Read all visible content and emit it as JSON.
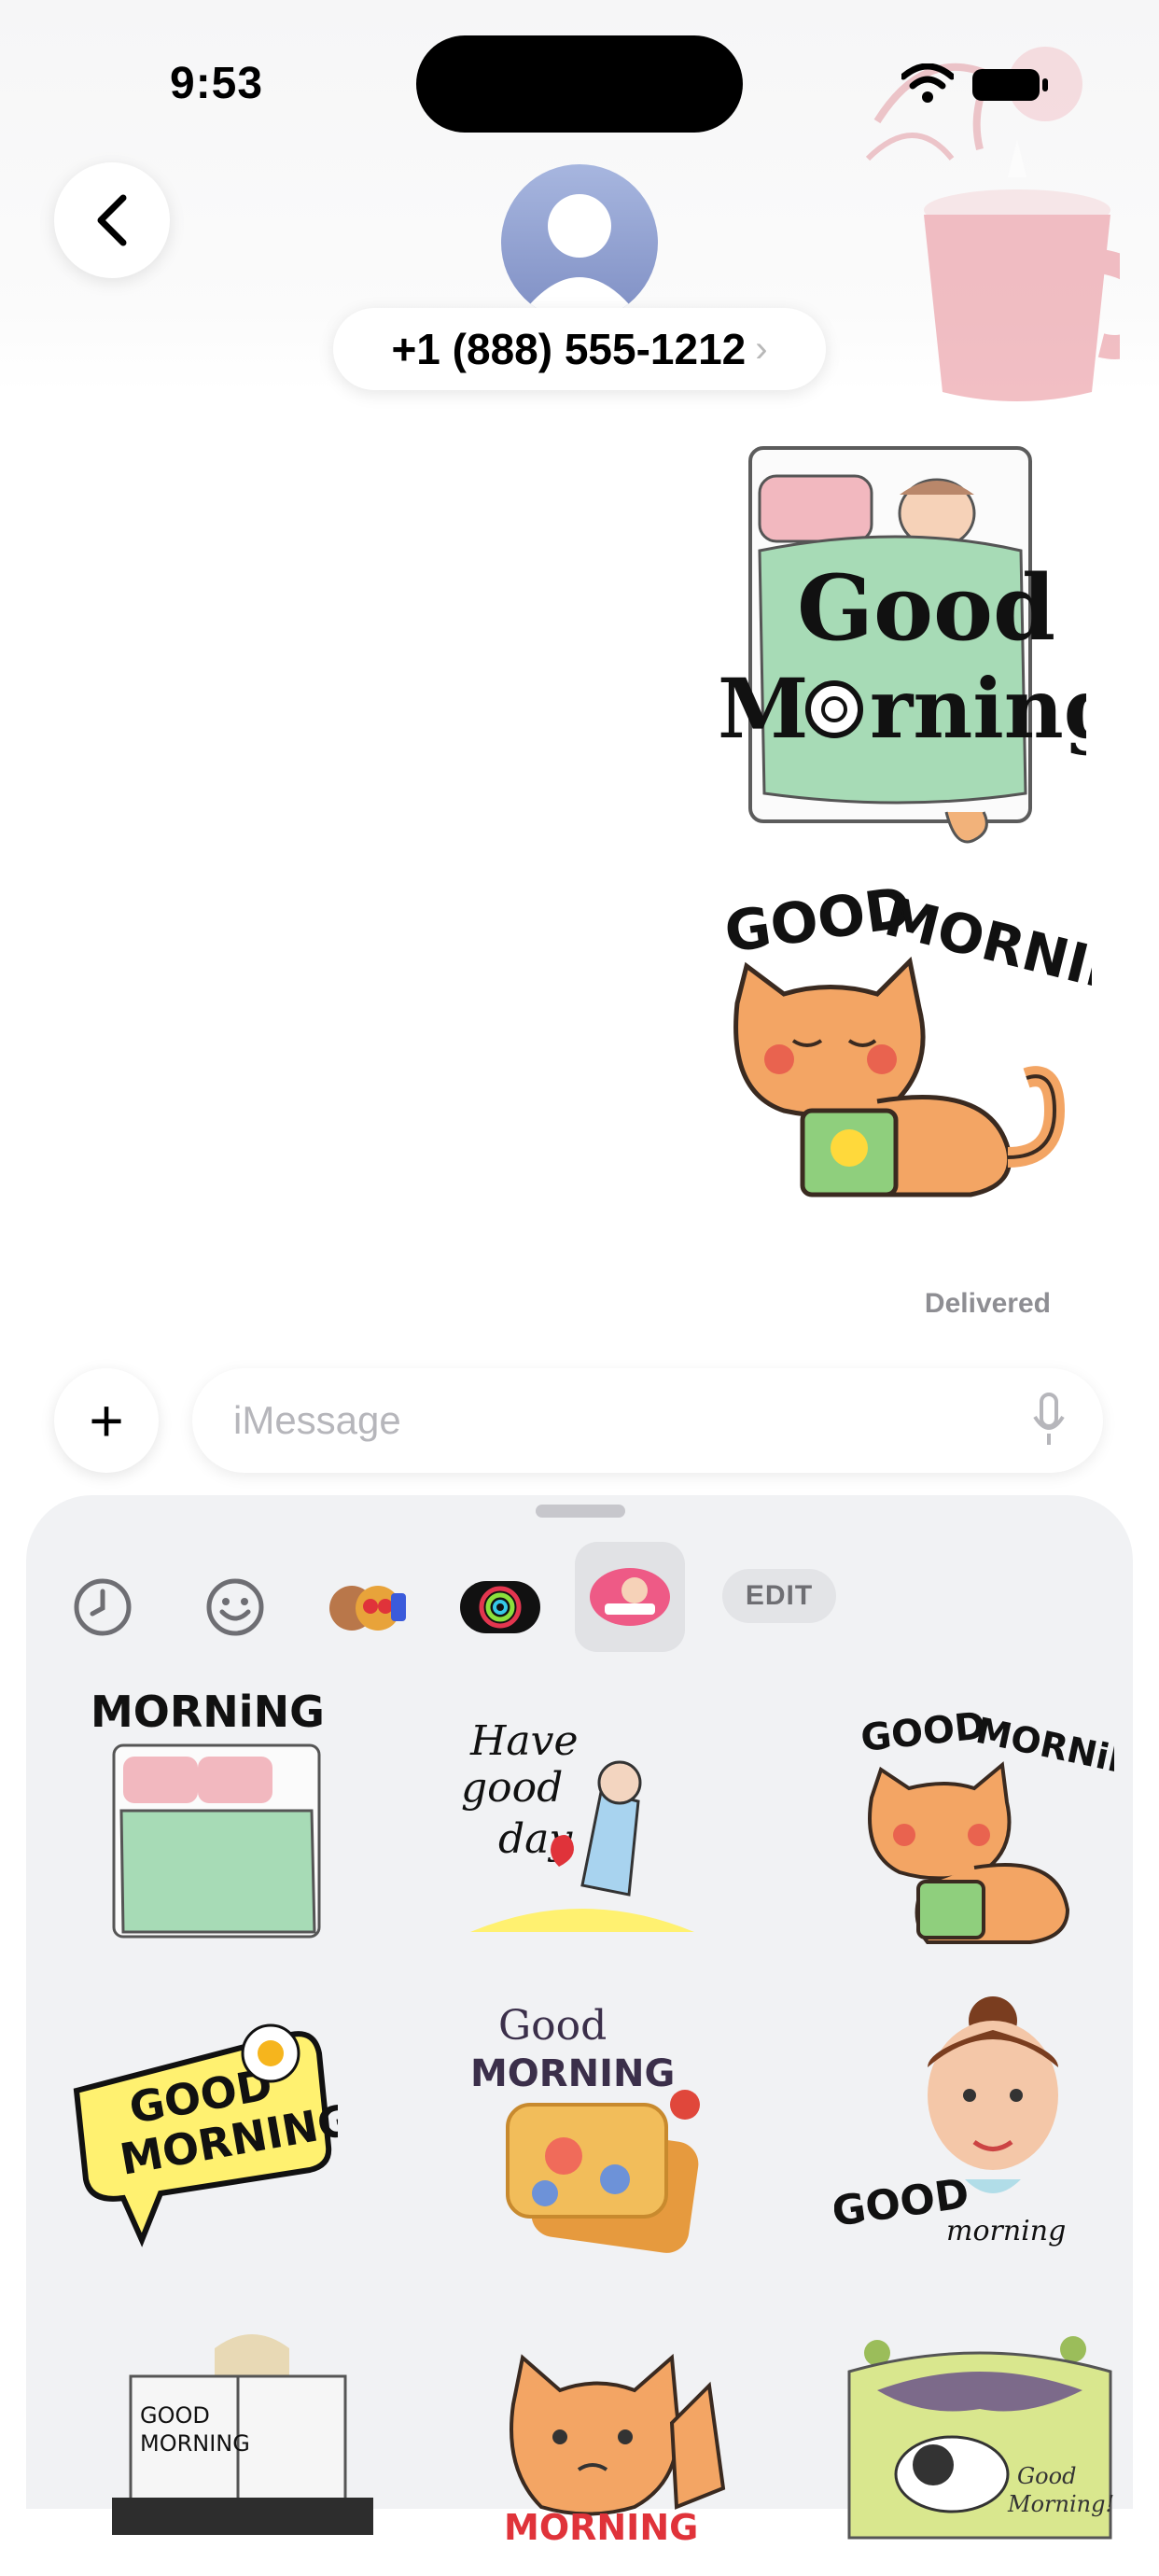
{
  "status_bar": {
    "time": "9:53"
  },
  "header": {
    "phone_number": "+1 (888) 555-1212",
    "chevron": "›"
  },
  "messages": {
    "status": "Delivered"
  },
  "compose": {
    "placeholder": "iMessage",
    "plus_label": "+"
  },
  "drawer": {
    "edit_label": "EDIT",
    "app_tabs": [
      "recents-icon",
      "emoji-icon",
      "memoji-icon",
      "activity-icon",
      "good-morning-stickers-icon"
    ]
  },
  "colors": {
    "accent_blue": "#8c9cd0",
    "drawer_bg": "#f1f2f4",
    "placeholder": "#b6b6bb",
    "delivered": "#8e8e93"
  }
}
